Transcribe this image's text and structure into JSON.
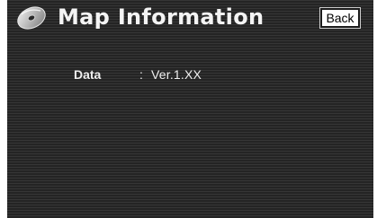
{
  "header": {
    "title": "Map Information",
    "icon": "disc-icon",
    "back_label": "Back"
  },
  "info": {
    "label": "Data",
    "separator": ":",
    "value": "Ver.1.XX"
  },
  "colors": {
    "background": "#2a2a2a",
    "text": "#f4f4f4",
    "button_bg": "#ffffff"
  }
}
